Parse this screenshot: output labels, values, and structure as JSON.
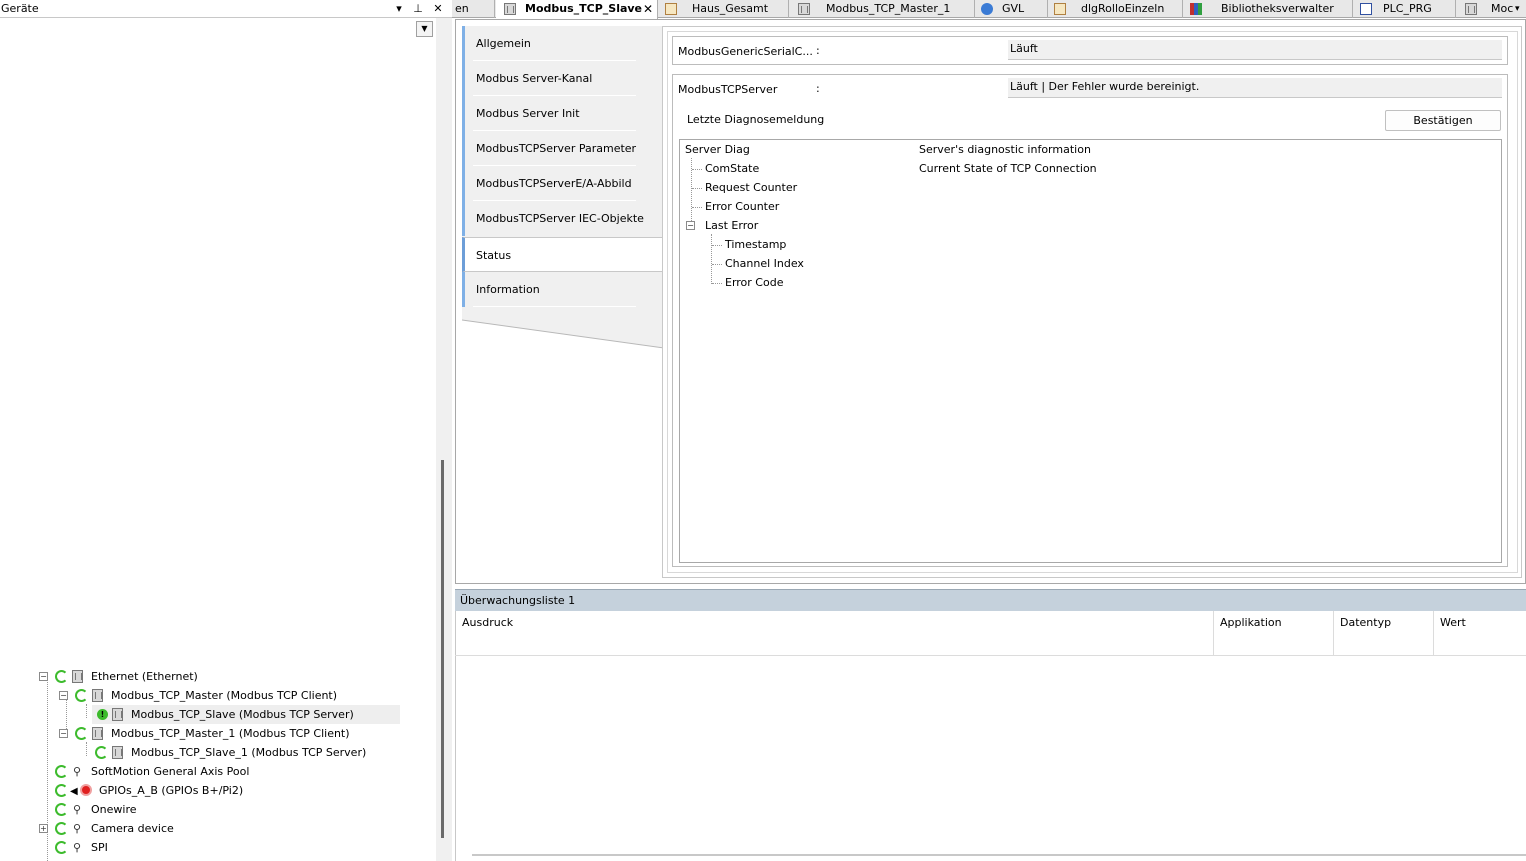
{
  "left_pane": {
    "title": "Geräte",
    "pin": "⊥",
    "close": "✕",
    "tree": [
      {
        "label": "Ethernet (Ethernet)"
      },
      {
        "label": "Modbus_TCP_Master (Modbus TCP Client)"
      },
      {
        "label": "Modbus_TCP_Slave (Modbus TCP Server)"
      },
      {
        "label": "Modbus_TCP_Master_1 (Modbus TCP Client)"
      },
      {
        "label": "Modbus_TCP_Slave_1 (Modbus TCP Server)"
      },
      {
        "label": "SoftMotion General Axis Pool"
      },
      {
        "label": "GPIOs_A_B (GPIOs B+/Pi2)"
      },
      {
        "label": "Onewire"
      },
      {
        "label": "Camera device"
      },
      {
        "label": "SPI"
      }
    ]
  },
  "tabs": [
    {
      "label": "en"
    },
    {
      "label": "Modbus_TCP_Slave"
    },
    {
      "label": "Haus_Gesamt"
    },
    {
      "label": "Modbus_TCP_Master_1"
    },
    {
      "label": "GVL"
    },
    {
      "label": "dlgRolloEinzeln"
    },
    {
      "label": "Bibliotheksverwalter"
    },
    {
      "label": "PLC_PRG"
    },
    {
      "label": "Moc"
    }
  ],
  "side_tabs": [
    {
      "label": "Allgemein"
    },
    {
      "label": "Modbus Server-Kanal"
    },
    {
      "label": "Modbus Server Init"
    },
    {
      "label": "ModbusTCPServer Parameter"
    },
    {
      "label": "ModbusTCPServerE/A-Abbild"
    },
    {
      "label": "ModbusTCPServer IEC-Objekte"
    },
    {
      "label": "Status"
    },
    {
      "label": "Information"
    }
  ],
  "status": {
    "generic": {
      "label": "ModbusGenericSerialC...",
      "colon": ":",
      "value": "Läuft"
    },
    "tcp": {
      "label": "ModbusTCPServer",
      "colon": ":",
      "value": "Läuft | Der Fehler wurde bereinigt."
    },
    "last_diag_label": "Letzte Diagnosemeldung",
    "confirm_button": "Bestätigen",
    "diag_tree": [
      {
        "name": "Server Diag",
        "desc": "Server's diagnostic information"
      },
      {
        "name": "ComState",
        "desc": "Current State of TCP Connection"
      },
      {
        "name": "Request Counter",
        "desc": ""
      },
      {
        "name": "Error Counter",
        "desc": ""
      },
      {
        "name": "Last Error",
        "desc": ""
      },
      {
        "name": "Timestamp",
        "desc": ""
      },
      {
        "name": "Channel Index",
        "desc": ""
      },
      {
        "name": "Error Code",
        "desc": ""
      }
    ]
  },
  "watch": {
    "title": "Überwachungsliste 1",
    "columns": [
      "Ausdruck",
      "Applikation",
      "Datentyp",
      "Wert"
    ]
  },
  "colors": {
    "accent_tab": "#7fb0e6",
    "watch_title_bg": "#c5d1dc",
    "status_ok_green": "#3dbb2d"
  }
}
